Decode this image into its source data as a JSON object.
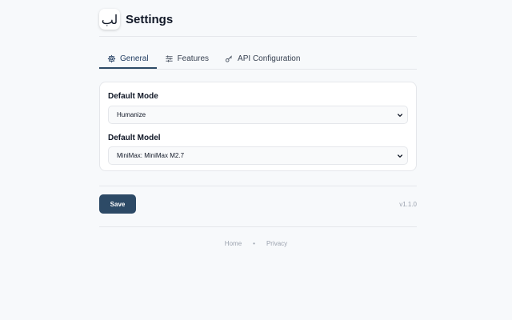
{
  "header": {
    "logo_text": "لب",
    "title": "Settings"
  },
  "tabs": [
    {
      "label": "General",
      "icon": "gear-icon",
      "active": true
    },
    {
      "label": "Features",
      "icon": "sliders-icon",
      "active": false
    },
    {
      "label": "API Configuration",
      "icon": "key-icon",
      "active": false
    }
  ],
  "form": {
    "mode_label": "Default Mode",
    "mode_value": "Humanize",
    "model_label": "Default Model",
    "model_value": "MiniMax: MiniMax M2.7"
  },
  "actions": {
    "save_label": "Save",
    "version": "v1.1.0"
  },
  "footer": {
    "home": "Home",
    "separator": "•",
    "privacy": "Privacy"
  },
  "colors": {
    "background": "#f7f9fb",
    "accent": "#2d4a66",
    "muted_text": "#9ca3af"
  }
}
